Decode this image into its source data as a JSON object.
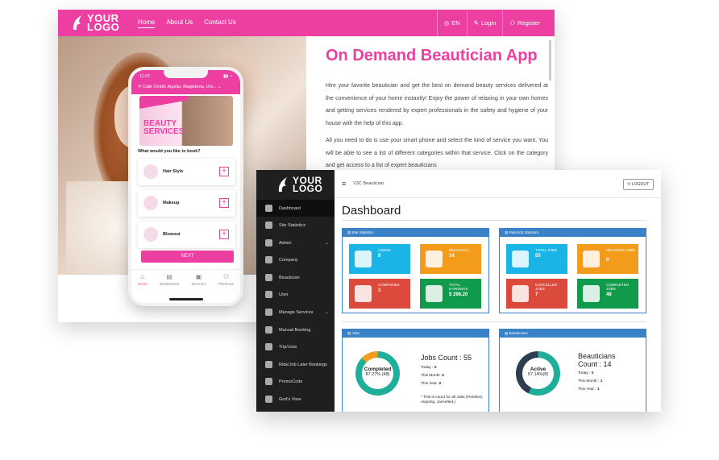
{
  "site": {
    "logo_top": "YOUR",
    "logo_bottom": "LOGO",
    "nav": [
      "Home",
      "About Us",
      "Contact Us"
    ],
    "lang": "EN",
    "login": "Login",
    "register": "Register",
    "title": "On Demand Beautician App",
    "para1": "Hire your favorite beautician and get the best on demand beauty services delivered at the convenience of your home instantly! Enjoy the power of relaxing in your own homes and getting services rendered by expert professionals in the safety and hygiene of your house with the help of this app.",
    "para2": "All you need to do is use your smart phone and select the kind of service you want. You will be able to see a list of different categories within that service. Click on the category and get access to a list of expert beauticians"
  },
  "phone": {
    "time": "11:07",
    "location": "Calle Ovidio Aguilar, Magisteria, Uni...",
    "banner": [
      "BEAUTY",
      "SERVICES"
    ],
    "question": "What would you like to book?",
    "services": [
      "Hair Style",
      "Makeup",
      "Blowout"
    ],
    "next": "NEXT",
    "tabs": [
      "Home",
      "BOOKINGS",
      "WALLET",
      "PROFILE"
    ]
  },
  "admin": {
    "logo_top": "YOUR",
    "logo_bottom": "LOGO",
    "brand": "V3C Beautician",
    "logout": "LOGOUT",
    "title": "Dashboard",
    "menu": [
      "Dashboard",
      "Site Statistics",
      "Admin",
      "Company",
      "Beautician",
      "User",
      "Manage Services",
      "Manual Booking",
      "Trip/Jobs",
      "Ride/Job Later Bookings",
      "PromoCode",
      "God's View"
    ],
    "site_stats": {
      "header": "Site Statistics",
      "tiles": [
        {
          "label": "USERS",
          "value": "8"
        },
        {
          "label": "BEAUTICIA...",
          "value": "14"
        },
        {
          "label": "COMPANIES",
          "value": "3"
        },
        {
          "label": "TOTAL EARNINGS",
          "value": "$ 298.20"
        }
      ]
    },
    "job_stats": {
      "header": "Ride/Job Statistics",
      "tiles": [
        {
          "label": "TOTAL JOBS",
          "value": "55"
        },
        {
          "label": "ON GOING JOBS",
          "value": "0"
        },
        {
          "label": "CANCELLED JOBS",
          "value": "7"
        },
        {
          "label": "COMPLETED JOBS",
          "value": "48"
        }
      ]
    },
    "jobs": {
      "header": "Jobs",
      "ring_label": "Completed",
      "ring_value": "87.27% (48)",
      "ring_fraction": 0.8727,
      "count": "Jobs Count : 55",
      "today": "0",
      "month": "2",
      "year": "2",
      "note": "* This is count for all Jobs (Finished, ongoing, cancelled.)"
    },
    "beauticians": {
      "header": "Beauticians",
      "ring_label": "Active",
      "ring_value": "57.14%(8)",
      "ring_fraction": 0.5714,
      "count_line1": "Beauticians",
      "count_line2": "Count : 14",
      "today": "0",
      "month": "1",
      "year": "1"
    },
    "labels": {
      "today": "Today :",
      "month": "This Month :",
      "year": "This Year :"
    }
  },
  "colors": {
    "brand_pink": "#ec3fa1",
    "panel_blue": "#3a81c6",
    "ring_teal": "#1fae9a",
    "ring_orange": "#f39c1b",
    "ring_dark": "#2c3e50"
  }
}
